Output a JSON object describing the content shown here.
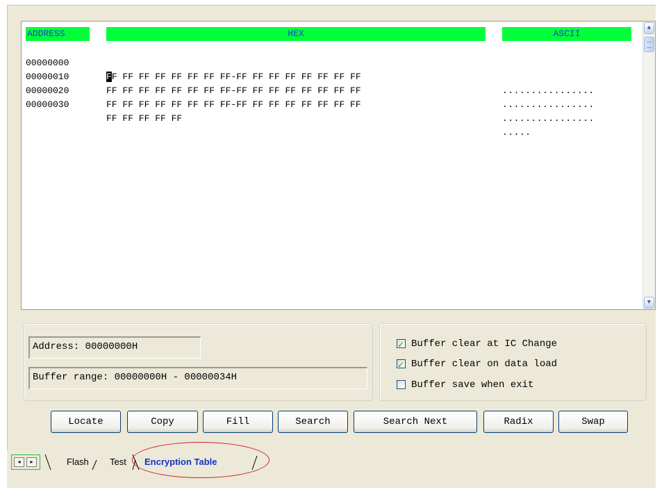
{
  "hex_view": {
    "headers": {
      "address": "ADDRESS",
      "hex": "HEX",
      "ascii": "ASCII"
    },
    "rows": [
      {
        "address": "00000000",
        "cursor_char": "F",
        "bytes": "F FF FF FF FF FF FF FF-FF FF FF FF FF FF FF FF",
        "ascii": "................"
      },
      {
        "address": "00000010",
        "cursor_char": "",
        "bytes": "FF FF FF FF FF FF FF FF-FF FF FF FF FF FF FF FF",
        "ascii": "................"
      },
      {
        "address": "00000020",
        "cursor_char": "",
        "bytes": "FF FF FF FF FF FF FF FF-FF FF FF FF FF FF FF FF",
        "ascii": "................"
      },
      {
        "address": "00000030",
        "cursor_char": "",
        "bytes": "FF FF FF FF FF",
        "ascii": "....."
      }
    ],
    "scroll_up_icon": "chevron-up-icon",
    "scroll_down_icon": "chevron-down-icon"
  },
  "info": {
    "address": "Address: 00000000H",
    "buffer_range": "Buffer range: 00000000H - 00000034H"
  },
  "options": [
    {
      "label": "Buffer clear at IC Change",
      "checked": true
    },
    {
      "label": "Buffer clear on data load",
      "checked": true
    },
    {
      "label": "Buffer save when exit",
      "checked": false
    }
  ],
  "buttons": {
    "locate": "Locate",
    "copy": "Copy",
    "fill": "Fill",
    "search": "Search",
    "search_next": "Search Next",
    "radix": "Radix",
    "swap": "Swap"
  },
  "tabs": {
    "prev_icon": "◂",
    "next_icon": "▸",
    "flash": "Flash",
    "test": "Test",
    "encryption_table": "Encryption Table"
  },
  "colors": {
    "header_bg": "#00ff3a",
    "header_text": "#2b3bd6",
    "highlight_ellipse": "#d42020",
    "active_tab": "#1233c8"
  }
}
